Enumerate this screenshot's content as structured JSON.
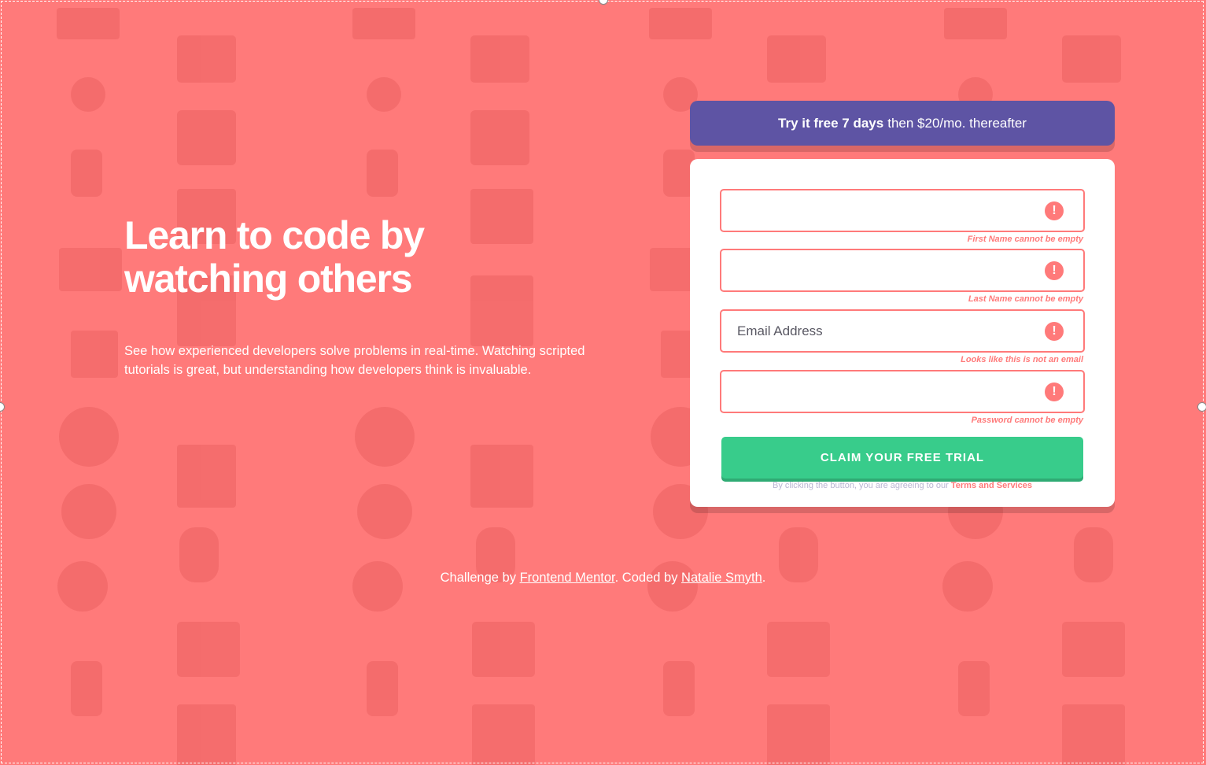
{
  "hero": {
    "title": "Learn to code by watching others",
    "description": "See how experienced developers solve problems in real-time. Watching scripted tutorials is great, but understanding how developers think is invaluable."
  },
  "banner": {
    "bold": "Try it free 7 days",
    "rest": "then $20/mo. thereafter"
  },
  "form": {
    "first_name": {
      "value": "",
      "error": "First Name cannot be empty"
    },
    "last_name": {
      "value": "",
      "error": "Last Name cannot be empty"
    },
    "email": {
      "placeholder": "Email Address",
      "error": "Looks like this is not an email"
    },
    "password": {
      "value": "",
      "error": "Password cannot be empty"
    },
    "error_icon_glyph": "!",
    "submit_label": "CLAIM YOUR FREE TRIAL",
    "terms_prefix": "By clicking the button, you are agreeing to our",
    "terms_link": "Terms and Services"
  },
  "footer": {
    "prefix": "Challenge by",
    "link1": "Frontend Mentor",
    "middle": ". Coded by",
    "link2": "Natalie Smyth",
    "suffix": "."
  },
  "colors": {
    "background": "#ff7a7a",
    "banner": "#5e54a4",
    "cta": "#38cc8b",
    "error": "#ff7a7a",
    "terms_text": "#b9b6d3"
  },
  "icons": [
    "house-icon",
    "toolbox-icon",
    "network-icon",
    "shapes-icon",
    "chain-icon",
    "browser-icon",
    "gear-icon",
    "search-icon",
    "cart-icon",
    "lifebuoy-icon",
    "lightbulb-icon",
    "rocket-icon",
    "pencil-icon",
    "chat-icon",
    "calendar-icon"
  ]
}
